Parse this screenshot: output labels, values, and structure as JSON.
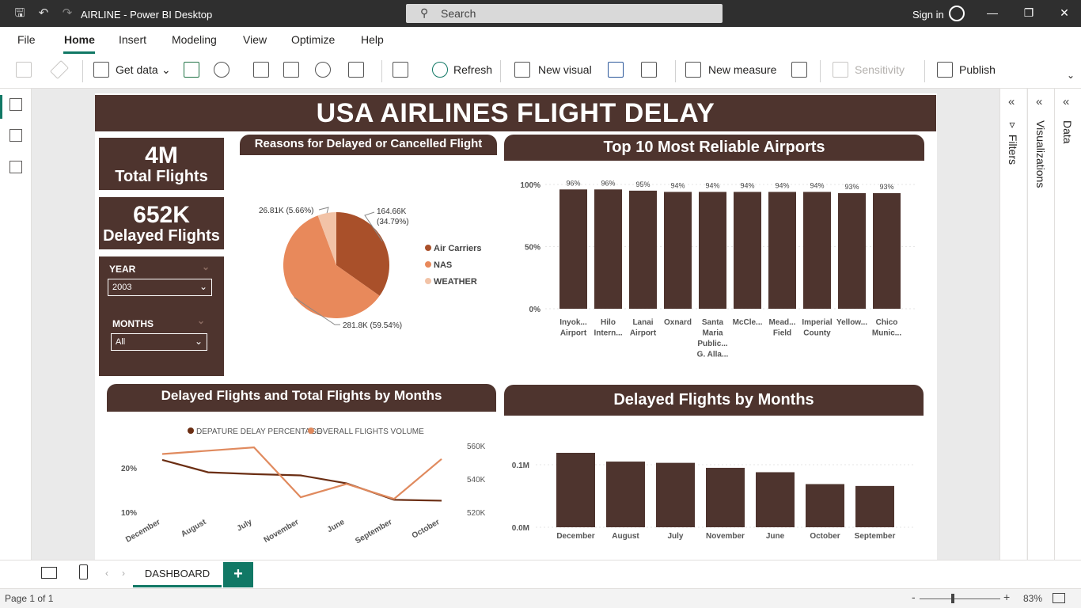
{
  "window": {
    "title": "AIRLINE - Power BI Desktop",
    "sign_in": "Sign in"
  },
  "search": {
    "placeholder": "Search"
  },
  "menu": [
    "File",
    "Home",
    "Insert",
    "Modeling",
    "View",
    "Optimize",
    "Help"
  ],
  "ribbon": {
    "get_data": "Get data",
    "refresh": "Refresh",
    "new_visual": "New visual",
    "new_measure": "New measure",
    "sensitivity": "Sensitivity",
    "publish": "Publish"
  },
  "panes": {
    "filters": "Filters",
    "visualizations": "Visualizations",
    "data": "Data"
  },
  "report": {
    "title": "USA AIRLINES FLIGHT DELAY",
    "kpi_total": {
      "value": "4M",
      "label": "Total Flights"
    },
    "kpi_delayed": {
      "value": "652K",
      "label": "Delayed Flights"
    },
    "slicer_year": {
      "label": "YEAR",
      "value": "2003"
    },
    "slicer_months": {
      "label": "MONTHS",
      "value": "All"
    }
  },
  "page_tabs": {
    "dashboard": "DASHBOARD"
  },
  "status": {
    "page": "Page 1 of 1",
    "zoom": "83%"
  },
  "colors": {
    "brown_dark": "#4e342e",
    "air_carriers": "#a9502a",
    "nas": "#e8895b",
    "weather": "#f2c3a7",
    "accent": "#117865"
  },
  "chart_data": [
    {
      "type": "pie",
      "title": "Reasons for Delayed or Cancelled Flight",
      "slices": [
        {
          "label": "Air Carriers",
          "value": 164.66,
          "percent": 34.79,
          "display": "164.66K (34.79%)",
          "color": "#a9502a"
        },
        {
          "label": "NAS",
          "value": 281.8,
          "percent": 59.54,
          "display": "281.8K (59.54%)",
          "color": "#e8895b"
        },
        {
          "label": "WEATHER",
          "value": 26.81,
          "percent": 5.66,
          "display": "26.81K (5.66%)",
          "color": "#f2c3a7"
        }
      ],
      "legend": "right"
    },
    {
      "type": "bar",
      "title": "Top 10 Most Reliable Airports",
      "categories": [
        [
          "Inyok...",
          "Airport"
        ],
        [
          "Hilo",
          "Intern..."
        ],
        [
          "Lanai",
          "Airport"
        ],
        [
          "Oxnard"
        ],
        [
          "Santa",
          "Maria",
          "Public...",
          "G. Alla..."
        ],
        [
          "McCle..."
        ],
        [
          "Mead...",
          "Field"
        ],
        [
          "Imperial",
          "County"
        ],
        [
          "Yellow..."
        ],
        [
          "Chico",
          "Munic..."
        ]
      ],
      "values": [
        96,
        96,
        95,
        94,
        94,
        94,
        94,
        94,
        93,
        93
      ],
      "data_labels": [
        "96%",
        "96%",
        "95%",
        "94%",
        "94%",
        "94%",
        "94%",
        "94%",
        "93%",
        "93%"
      ],
      "yticks": [
        "0%",
        "50%",
        "100%"
      ],
      "ylim": [
        0,
        100
      ]
    },
    {
      "type": "line",
      "title": "Delayed Flights and Total Flights by Months",
      "categories": [
        "December",
        "August",
        "July",
        "November",
        "June",
        "September",
        "October"
      ],
      "series": [
        {
          "name": "DEPATURE DELAY PERCENTAGE",
          "axis": "left",
          "values": [
            21.8,
            19.0,
            18.6,
            18.3,
            16.5,
            12.8,
            12.6
          ],
          "color": "#6b2e13"
        },
        {
          "name": "OVERALL FLIGHTS VOLUME",
          "axis": "right",
          "values": [
            555,
            557,
            559,
            529,
            537,
            528,
            552
          ],
          "color": "#e08a5e"
        }
      ],
      "yticks_left": [
        "10%",
        "20%"
      ],
      "ylim_left": [
        10,
        20
      ],
      "yticks_right": [
        "520K",
        "540K",
        "560K"
      ],
      "ylim_right": [
        520,
        560
      ]
    },
    {
      "type": "bar",
      "title": "Delayed Flights by Months",
      "categories": [
        "December",
        "August",
        "July",
        "November",
        "June",
        "October",
        "September"
      ],
      "values": [
        0.119,
        0.105,
        0.103,
        0.095,
        0.088,
        0.069,
        0.066
      ],
      "yticks": [
        "0.0M",
        "0.1M"
      ],
      "ylim": [
        0,
        0.1
      ]
    }
  ]
}
